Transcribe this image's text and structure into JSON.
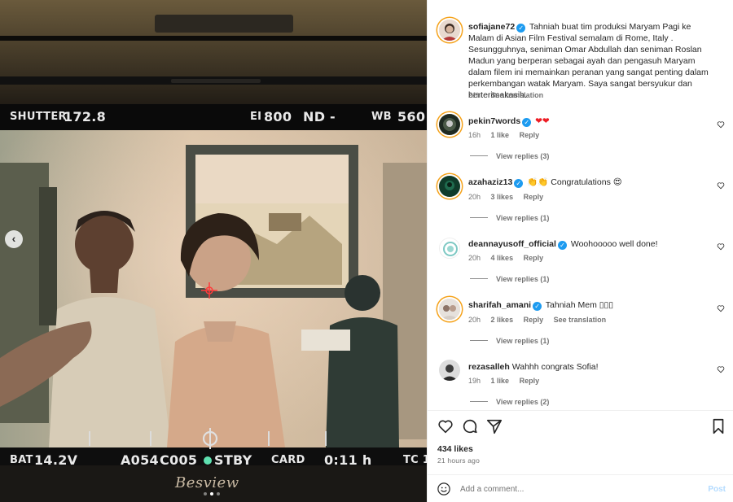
{
  "media": {
    "hud_top": {
      "shutter_label": "SHUTTER",
      "shutter_value": "172.8",
      "ei_label": "EI",
      "ei_value": "800",
      "nd_label": "ND",
      "nd_value": "-",
      "wb_label": "WB",
      "wb_value": "560"
    },
    "hud_bottom": {
      "bat_label": "BAT",
      "bat_value": "14.2V",
      "clip_a": "A054",
      "clip_c": "C005",
      "status": "STBY",
      "card_label": "CARD",
      "time_value": "0:11 h",
      "tc_label": "TC 1"
    },
    "brand": "Besview",
    "carousel_prev_icon": "chevron-left-icon",
    "dots": 3,
    "active_dot": 2
  },
  "caption": {
    "username": "sofiajane72",
    "text": "Tahniah buat tim produksi Maryam Pagi ke Malam di Asian Film Festival semalam di Rome, Italy . Sesungguhnya, seniman Omar Abdullah dan seniman Roslan Madun yang berperan sebagai ayah dan pengasuh Maryam dalam filem ini memainkan peranan yang sangat penting dalam perkembangan watak Maryam. Saya sangat bersyukur dan berterimakasih.",
    "time": "21h",
    "see_translation": "See translation"
  },
  "comments": [
    {
      "username": "pekin7words",
      "text": "❤❤",
      "time": "16h",
      "likes": "1 like",
      "reply": "Reply",
      "view_replies": "View replies (3)"
    },
    {
      "username": "azahaziz13",
      "text": "👏👏 Congratulations 😍",
      "time": "20h",
      "likes": "3 likes",
      "reply": "Reply",
      "view_replies": "View replies (1)"
    },
    {
      "username": "deannayusoff_official",
      "text": "Woohooooo well done!",
      "time": "20h",
      "likes": "4 likes",
      "reply": "Reply",
      "view_replies": "View replies (1)"
    },
    {
      "username": "sharifah_amani",
      "text": "Tahniah Mem ▯▯▯",
      "time": "20h",
      "likes": "2 likes",
      "reply": "Reply",
      "see_translation": "See translation",
      "view_replies": "View replies (1)"
    },
    {
      "username": "rezasalleh",
      "text": "Wahhh congrats Sofia!",
      "time": "19h",
      "likes": "1 like",
      "reply": "Reply",
      "view_replies": "View replies (2)"
    }
  ],
  "footer": {
    "likes": "434 likes",
    "ago": "21 hours ago",
    "add_comment_placeholder": "Add a comment...",
    "post_label": "Post"
  },
  "colors": {
    "accent_blue": "#0095f6",
    "post_disabled": "#b3dbff",
    "verified": "#1d9bf0",
    "heart_red": "#ed1c24",
    "story_ring": "#f5a21a"
  }
}
